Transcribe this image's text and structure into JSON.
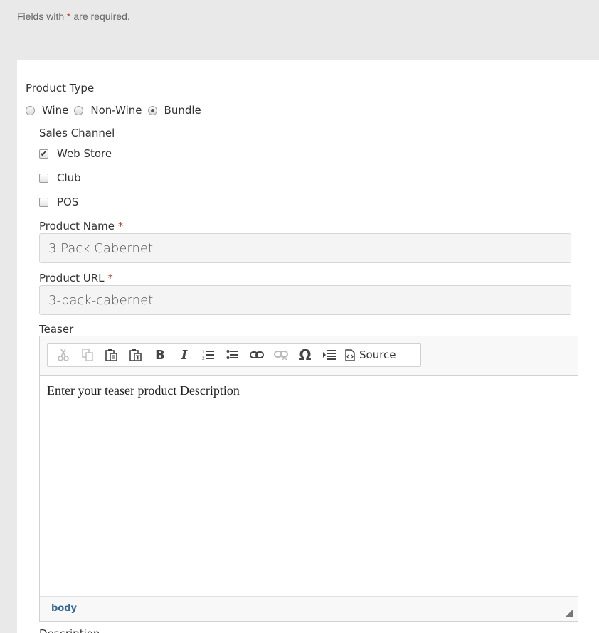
{
  "notice": {
    "prefix": "Fields with ",
    "star": "*",
    "suffix": " are required."
  },
  "product_type": {
    "label": "Product Type",
    "options": [
      {
        "label": "Wine",
        "selected": false
      },
      {
        "label": "Non-Wine",
        "selected": false
      },
      {
        "label": "Bundle",
        "selected": true
      }
    ]
  },
  "sales_channel": {
    "label": "Sales Channel",
    "options": [
      {
        "label": "Web Store",
        "checked": true
      },
      {
        "label": "Club",
        "checked": false
      },
      {
        "label": "POS",
        "checked": false
      }
    ]
  },
  "product_name": {
    "label": "Product Name",
    "star": "*",
    "value": "3 Pack Cabernet"
  },
  "product_url": {
    "label": "Product URL",
    "star": "*",
    "value": "3-pack-cabernet"
  },
  "teaser": {
    "label": "Teaser",
    "toolbar": {
      "buttons": [
        "cut-icon",
        "copy-icon",
        "paste-icon",
        "paste-text-icon",
        "bold-icon",
        "italic-icon",
        "numbered-list-icon",
        "bulleted-list-icon",
        "link-icon",
        "unlink-icon",
        "special-char-icon",
        "indent-icon"
      ],
      "source_label": "Source"
    },
    "content": "Enter your teaser product Description",
    "path": "body"
  },
  "next_label": "Description"
}
